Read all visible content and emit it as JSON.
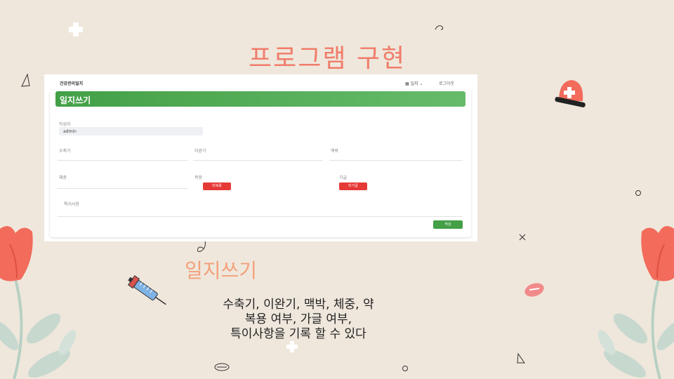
{
  "slide": {
    "title": "프로그램 구현",
    "subtitle": "일지쓰기",
    "description_lines": [
      "수축기, 이완기, 맥박, 체중, 약",
      "복용 여부, 가글 여부,",
      "특이사항을 기록 할 수 있다"
    ]
  },
  "app": {
    "name": "건강관리일지",
    "nav_diary": "일지",
    "nav_logout": "로그아웃",
    "card_title": "일지쓰기",
    "fields": {
      "author_label": "작성자",
      "author_value": "admin",
      "systolic_label": "수축기",
      "diastolic_label": "이완기",
      "pulse_label": "맥박",
      "weight_label": "체중",
      "medication_label": "복용",
      "gargle_label": "가글",
      "notes_label": "특이사항"
    },
    "buttons": {
      "medication": "미복용",
      "gargle": "미가글",
      "save": "작성"
    }
  },
  "colors": {
    "background": "#efe7dc",
    "title": "#f07c6a",
    "subtitle": "#f3a07a",
    "header_green": "#43a047",
    "button_red": "#e53935"
  },
  "icons": [
    "first-aid-cross-icon",
    "siren-icon",
    "syringe-icon",
    "pill-icon",
    "flower-icon",
    "leaf-icon"
  ]
}
